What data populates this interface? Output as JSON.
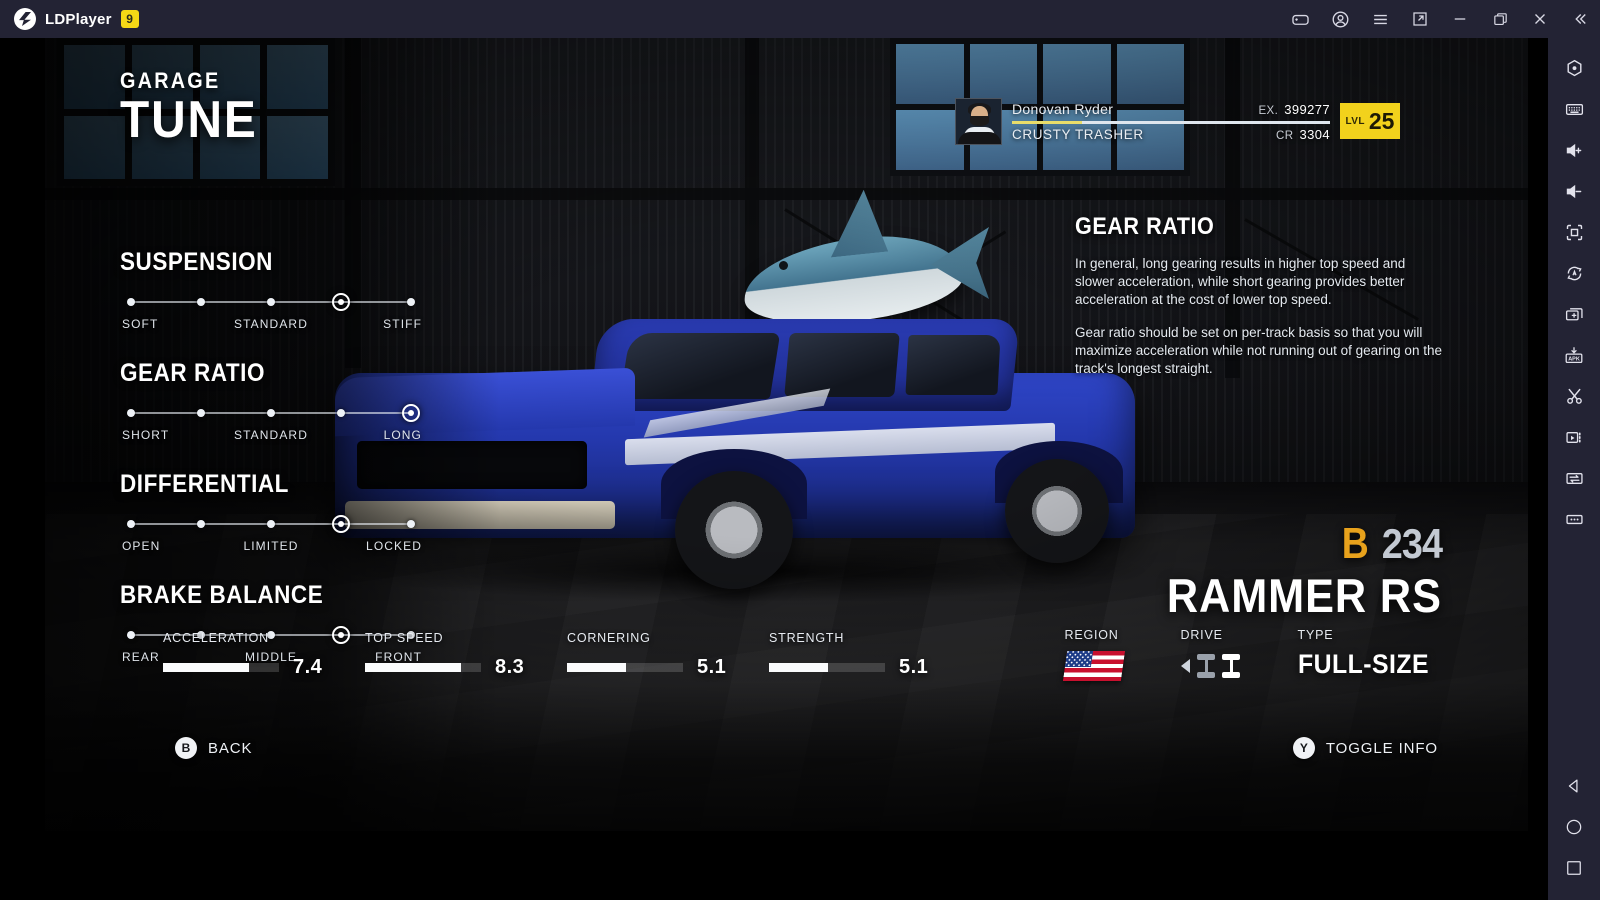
{
  "window": {
    "app_name": "LDPlayer",
    "version_badge": "9",
    "controls": [
      {
        "name": "gamepad-icon",
        "label": "Game Center"
      },
      {
        "name": "account-icon",
        "label": "Account"
      },
      {
        "name": "menu-icon",
        "label": "Menu"
      },
      {
        "name": "new-window-icon",
        "label": "New Window"
      },
      {
        "name": "minimize-icon",
        "label": "Minimize"
      },
      {
        "name": "maximize-icon",
        "label": "Maximize"
      },
      {
        "name": "close-icon",
        "label": "Close"
      },
      {
        "name": "collapse-icon",
        "label": "Collapse"
      }
    ]
  },
  "sidebar": {
    "items": [
      {
        "name": "settings-icon",
        "label": "Settings"
      },
      {
        "name": "keyboard-icon",
        "label": "Keyboard Mapping"
      },
      {
        "name": "volume-up-icon",
        "label": "Volume Up"
      },
      {
        "name": "volume-down-icon",
        "label": "Volume Down"
      },
      {
        "name": "fullscreen-icon",
        "label": "Fullscreen"
      },
      {
        "name": "auto-rotate-icon",
        "label": "Auto Rotate"
      },
      {
        "name": "multi-instance-icon",
        "label": "Multi Instance"
      },
      {
        "name": "install-apk-icon",
        "label": "Install APK"
      },
      {
        "name": "screenshot-icon",
        "label": "Screenshot"
      },
      {
        "name": "record-icon",
        "label": "Record"
      },
      {
        "name": "shared-folder-icon",
        "label": "Shared Folder"
      },
      {
        "name": "more-icon",
        "label": "More"
      }
    ],
    "nav": [
      {
        "name": "android-back-icon",
        "label": "Back"
      },
      {
        "name": "android-home-icon",
        "label": "Home"
      },
      {
        "name": "android-recents-icon",
        "label": "Recents"
      }
    ]
  },
  "header": {
    "kicker": "GARAGE",
    "title": "TUNE"
  },
  "player": {
    "name": "Donovan Ryder",
    "club": "CRUSTY TRASHER",
    "ex_label": "EX.",
    "ex_value": "399277",
    "cr_label": "CR",
    "cr_value": "3304",
    "level_label": "LVL",
    "level_value": "25",
    "xp_percent": 22
  },
  "tune": {
    "positions": 5,
    "groups": [
      {
        "label": "SUSPENSION",
        "selected_index": 3,
        "ticks": [
          "SOFT",
          "STANDARD",
          "STIFF"
        ]
      },
      {
        "label": "GEAR RATIO",
        "selected_index": 4,
        "ticks": [
          "SHORT",
          "STANDARD",
          "LONG"
        ]
      },
      {
        "label": "DIFFERENTIAL",
        "selected_index": 3,
        "ticks": [
          "OPEN",
          "LIMITED",
          "LOCKED"
        ]
      },
      {
        "label": "BRAKE BALANCE",
        "selected_index": 3,
        "ticks": [
          "REAR",
          "MIDDLE",
          "FRONT"
        ]
      }
    ]
  },
  "info": {
    "title": "GEAR RATIO",
    "paragraph1": "In general, long gearing results in higher top speed and slower acceleration, while short gearing provides better acceleration at the cost of lower top speed.",
    "paragraph2": "Gear ratio should be set on per-track basis so that you will maximize acceleration while not running out of gearing on the track's longest straight."
  },
  "car": {
    "class_letter": "B",
    "class_number": "234",
    "model": "RAMMER RS",
    "class_color": "#e8a21c"
  },
  "stats": [
    {
      "name": "ACCELERATION",
      "value": "7.4",
      "percent": 74
    },
    {
      "name": "TOP SPEED",
      "value": "8.3",
      "percent": 83
    },
    {
      "name": "CORNERING",
      "value": "5.1",
      "percent": 51
    },
    {
      "name": "STRENGTH",
      "value": "5.1",
      "percent": 51
    }
  ],
  "meta": {
    "region_label": "REGION",
    "region_value": "United States",
    "drive_label": "DRIVE",
    "drive_value": "Rear Wheel Drive",
    "type_label": "TYPE",
    "type_value": "FULL-SIZE"
  },
  "prompts": {
    "back_button": "B",
    "back_label": "BACK",
    "toggle_button": "Y",
    "toggle_label": "TOGGLE INFO"
  }
}
